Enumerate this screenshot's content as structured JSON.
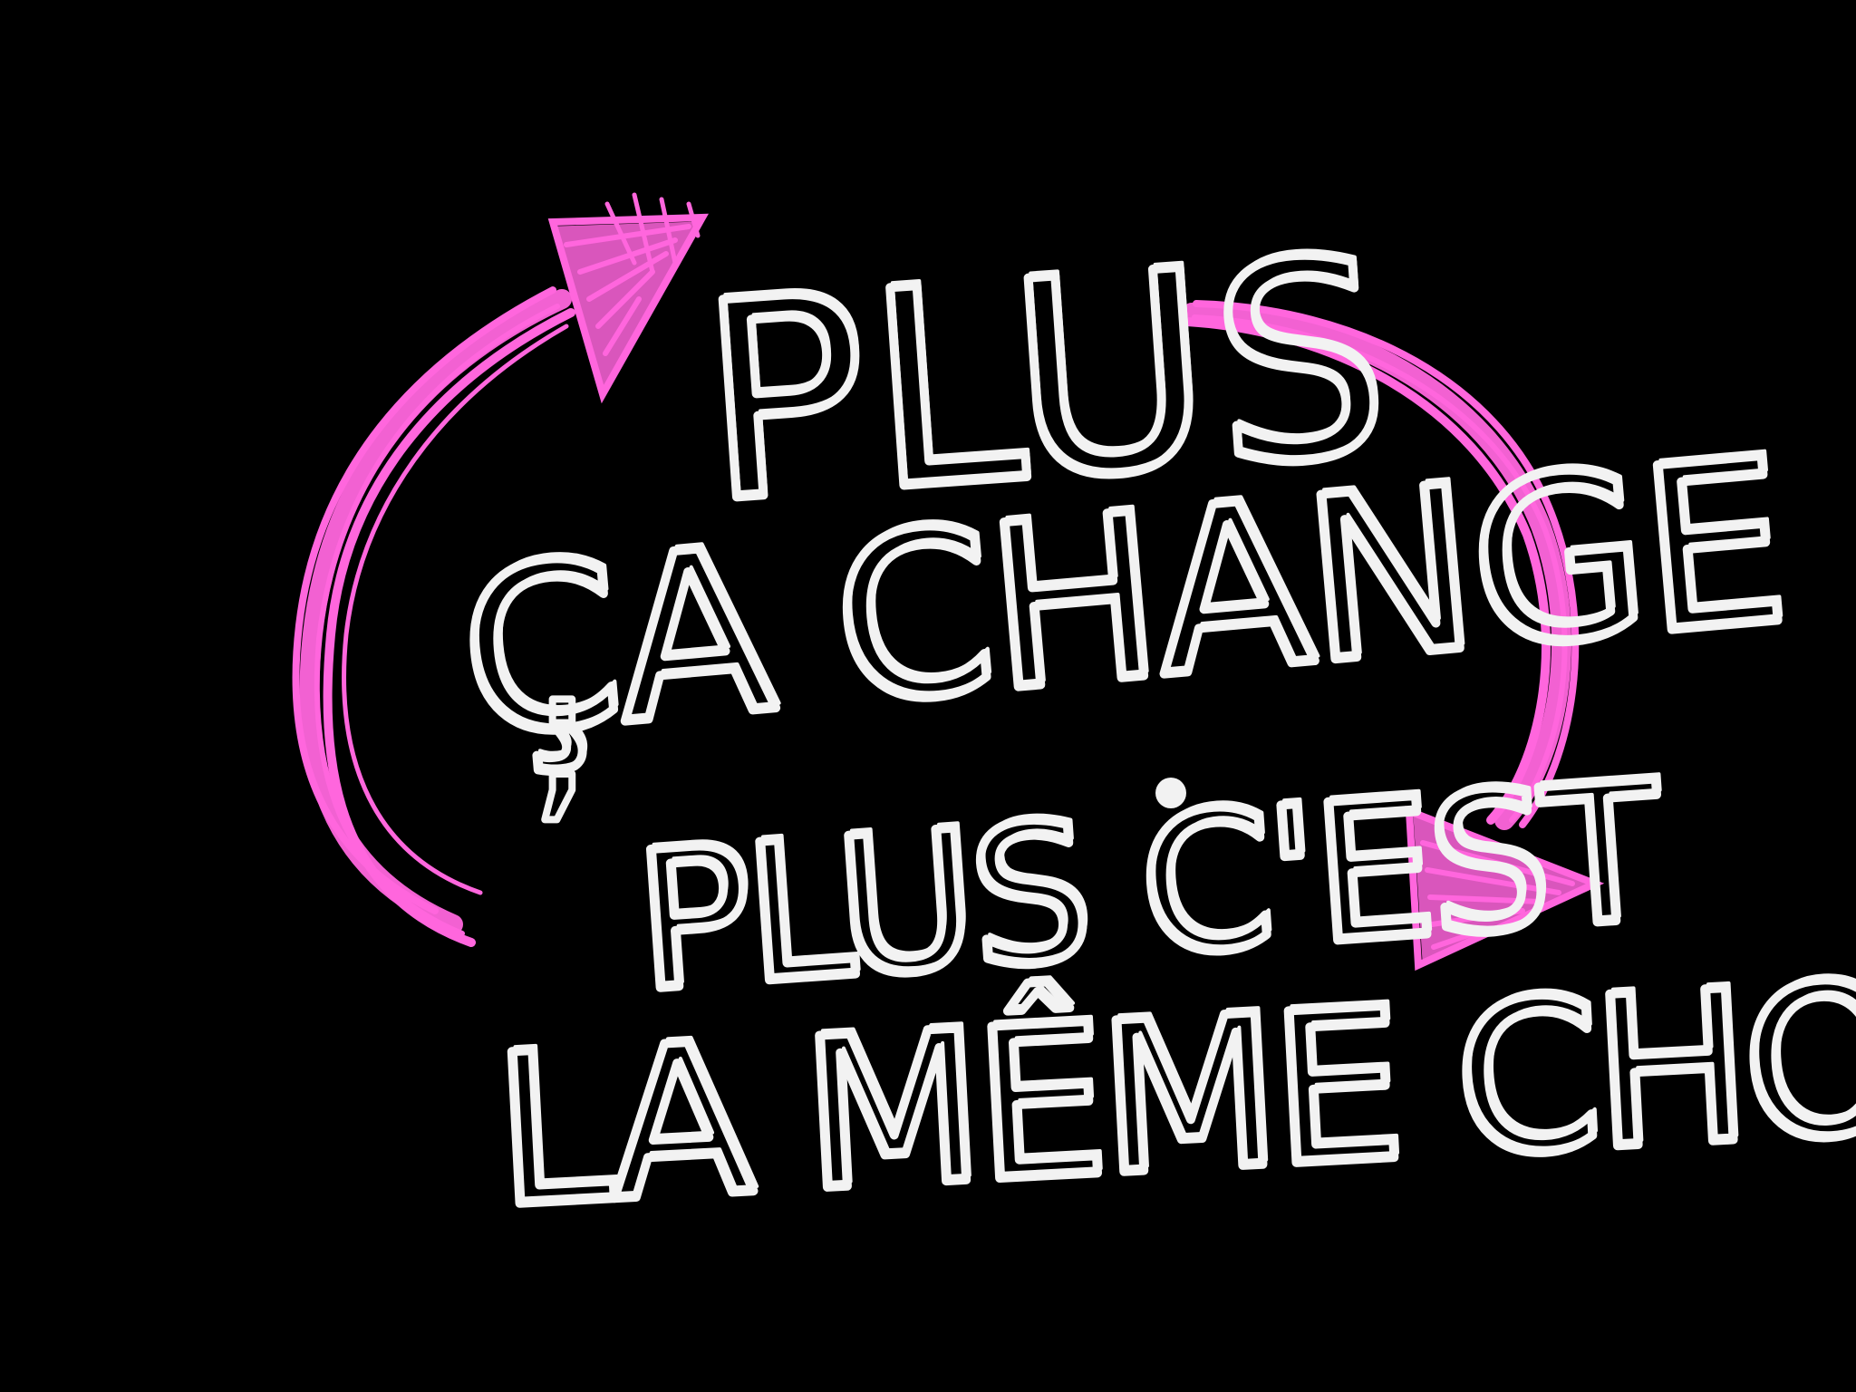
{
  "lettering": {
    "line1": "PLUS",
    "line2": "ÇA CHANGE",
    "line3": "PLUS C'EST",
    "line4": "LA MÊME CHOSE",
    "semicolon": ";"
  },
  "colors": {
    "background": "#000000",
    "text": "#f2f2f2",
    "arrow": "#ff66dd"
  },
  "icons": {
    "left_arrow": "curved-arrow-up-icon",
    "right_arrow": "curved-arrow-down-icon"
  }
}
